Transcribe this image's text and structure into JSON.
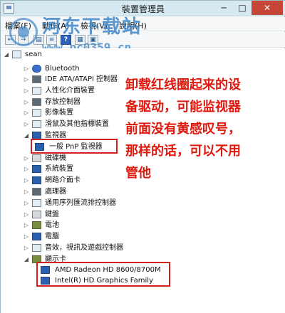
{
  "window": {
    "title": "裝置管理員",
    "min": "─",
    "max": "□",
    "close": "✕"
  },
  "menu": [
    "檔案(F)",
    "動作(A)",
    "檢視(V)",
    "說明(H)"
  ],
  "toolbar": [
    "←",
    "→",
    "▤",
    "≡",
    "?",
    "▦",
    "▣"
  ],
  "watermark": {
    "name": "河东下载站",
    "url": "www.pc0359.cn"
  },
  "tree": {
    "root": "sean",
    "items": [
      "Bluetooth",
      "IDE ATA/ATAPI 控制器",
      "人性化介面裝置",
      "存放控制器",
      "影像裝置",
      "滑鼠及其他指標裝置",
      "監視器",
      "一般 PnP 監視器",
      "磁碟機",
      "系統裝置",
      "網路介面卡",
      "處理器",
      "通用序列匯流排控制器",
      "鍵盤",
      "電池",
      "電腦",
      "音效，視訊及遊戲控制器",
      "顯示卡",
      "AMD Radeon HD 8600/8700M",
      "Intel(R) HD Graphics Family"
    ]
  },
  "annotation": {
    "lines": [
      "卸载红线圈起来的设",
      "备驱动，可能监视器",
      "前面没有黄感叹号，",
      "那样的话，可以不用",
      "管他"
    ]
  },
  "colors": {
    "highlight_box": "#d0211e",
    "annotation": "#e0190f",
    "title_bar": "#d6e8f0"
  }
}
